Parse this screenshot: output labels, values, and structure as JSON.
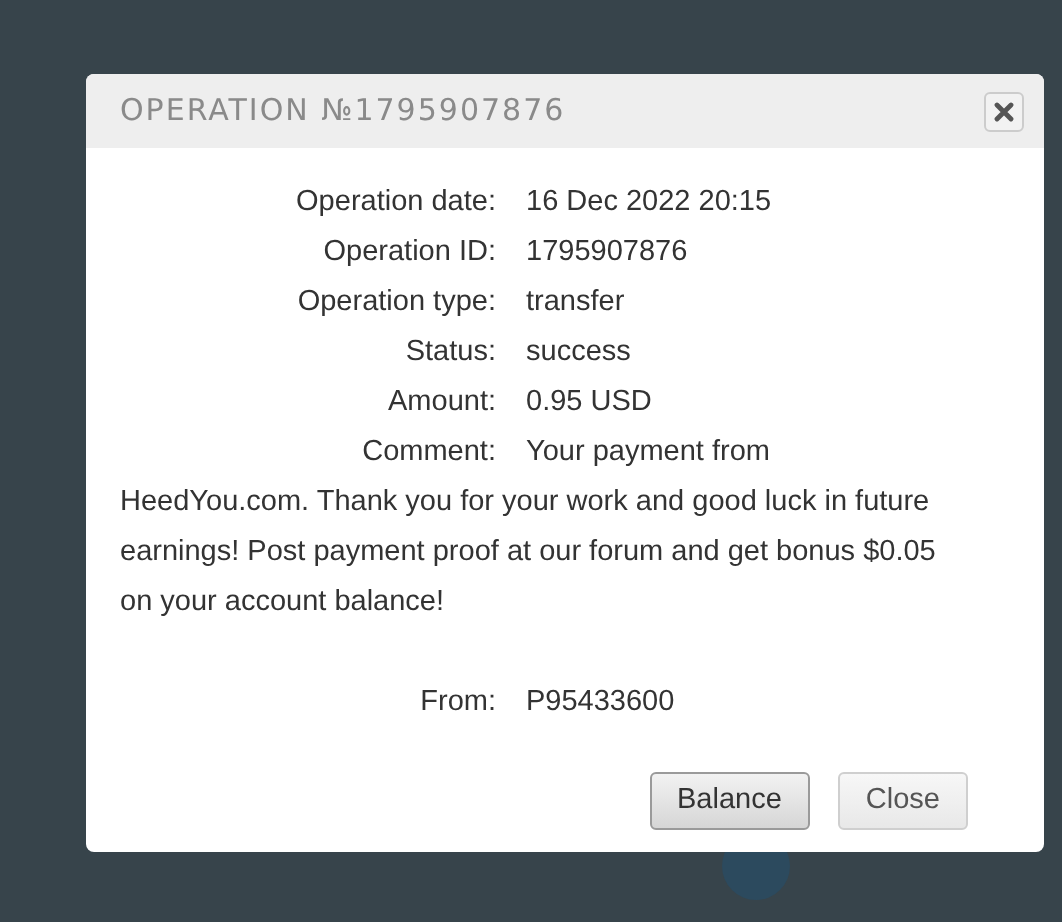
{
  "dialog": {
    "title": "OPERATION №1795907876",
    "fields": [
      {
        "label": "Operation date:",
        "value": "16 Dec 2022 20:15"
      },
      {
        "label": "Operation ID:",
        "value": "1795907876"
      },
      {
        "label": "Operation type:",
        "value": "transfer"
      },
      {
        "label": "Status:",
        "value": "success"
      },
      {
        "label": "Amount:",
        "value": "0.95 USD"
      }
    ],
    "comment": {
      "label": "Comment:",
      "first_line": "Your payment from",
      "rest": "HeedYou.com. Thank you for your work and good luck in future earnings! Post payment proof at our forum and get bonus $0.05 on your account balance!"
    },
    "from": {
      "label": "From:",
      "value": "P95433600"
    },
    "buttons": [
      {
        "label": "Balance",
        "kind": "primary"
      },
      {
        "label": "Close",
        "kind": "secondary"
      }
    ]
  }
}
